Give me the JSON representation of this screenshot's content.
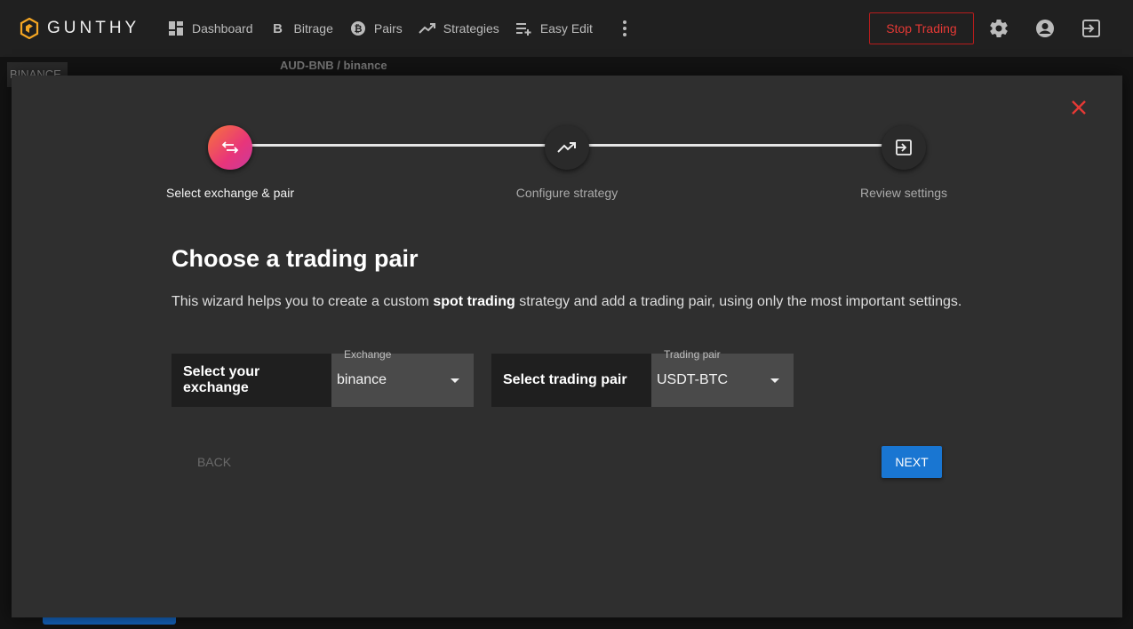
{
  "app": {
    "logo_text": "GUNTHY"
  },
  "nav": {
    "items": [
      {
        "label": "Dashboard",
        "icon": "dashboard-icon"
      },
      {
        "label": "Bitrage",
        "icon": "bitrage-b-icon"
      },
      {
        "label": "Pairs",
        "icon": "bitcoin-icon"
      },
      {
        "label": "Strategies",
        "icon": "trending-up-icon"
      },
      {
        "label": "Easy Edit",
        "icon": "playlist-add-icon"
      }
    ],
    "more_icon": "more-vert-icon"
  },
  "header": {
    "stop_trading_label": "Stop Trading",
    "settings_icon": "gear-icon",
    "account_icon": "account-circle-icon",
    "logout_icon": "logout-icon"
  },
  "background": {
    "exchange_chip": "BINANCE",
    "pair_title": "AUD-BNB / binance"
  },
  "wizard": {
    "close_icon": "close-icon",
    "steps": [
      {
        "label": "Select exchange & pair",
        "icon": "swap-icon",
        "active": true
      },
      {
        "label": "Configure strategy",
        "icon": "trending-up-icon",
        "active": false
      },
      {
        "label": "Review settings",
        "icon": "exit-to-app-icon",
        "active": false
      }
    ],
    "heading": "Choose a trading pair",
    "description": {
      "before": "This wizard helps you to create a custom ",
      "bold": "spot trading",
      "after": " strategy and add a trading pair, using only the most important settings."
    },
    "exchange": {
      "label": "Select your exchange",
      "float_label": "Exchange",
      "value": "binance"
    },
    "pair": {
      "label": "Select trading pair",
      "float_label": "Trading pair",
      "value": "USDT-BTC"
    },
    "back_label": "BACK",
    "next_label": "NEXT"
  },
  "colors": {
    "accent_blue": "#1976d2",
    "stop_red": "#e53935",
    "step_gradient_start": "#f7753a",
    "step_gradient_end": "#c93a9c",
    "logo_gold": "#f5a623"
  }
}
